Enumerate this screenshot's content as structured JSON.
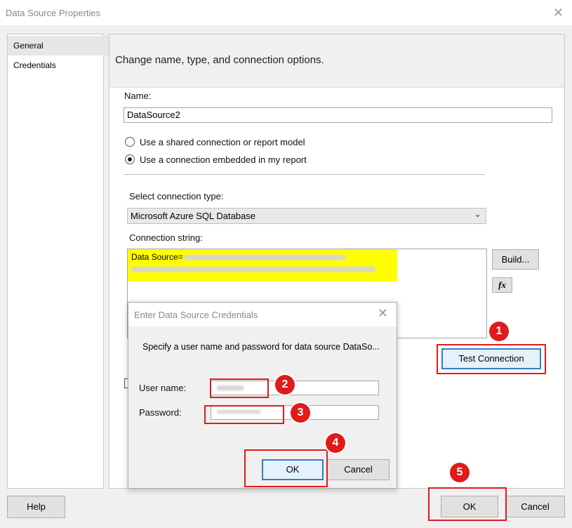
{
  "window": {
    "title": "Data Source Properties"
  },
  "sidebar": {
    "items": [
      {
        "label": "General"
      },
      {
        "label": "Credentials"
      }
    ]
  },
  "main": {
    "heading": "Change name, type, and connection options.",
    "name_label": "Name:",
    "name_value": "DataSource2",
    "radio_shared_label": "Use a shared connection or report model",
    "radio_embedded_label": "Use a connection embedded in my report",
    "connection_type_label": "Select connection type:",
    "connection_type_value": "Microsoft Azure SQL Database",
    "connection_string_label": "Connection string:",
    "connection_string_prefix": "Data Source=",
    "build_label": "Build...",
    "fx_label": "fx",
    "test_connection_label": "Test Connection"
  },
  "credentials_dialog": {
    "title": "Enter Data Source Credentials",
    "instruction": "Specify a user name and password for data source DataSo...",
    "username_label": "User name:",
    "password_label": "Password:",
    "ok_label": "OK",
    "cancel_label": "Cancel"
  },
  "footer": {
    "help_label": "Help",
    "ok_label": "OK",
    "cancel_label": "Cancel"
  },
  "annotations": {
    "step1": "1",
    "step2": "2",
    "step3": "3",
    "step4": "4",
    "step5": "5"
  },
  "colors": {
    "callout": "#e01b1b",
    "highlight": "#ffff00",
    "focus_border": "#2f7fc8"
  }
}
